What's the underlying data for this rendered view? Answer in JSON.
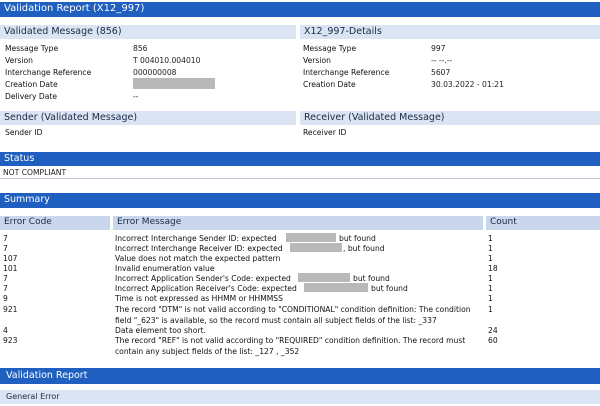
{
  "title": "Validation Report (X12_997)",
  "validated_message": {
    "heading": "Validated Message (856)",
    "rows": [
      {
        "label": "Message Type",
        "value": "856"
      },
      {
        "label": "Version",
        "value": "T 004010.004010"
      },
      {
        "label": "Interchange Reference",
        "value": "000000008"
      },
      {
        "label": "Creation Date",
        "value": ""
      },
      {
        "label": "Delivery Date",
        "value": "--"
      }
    ]
  },
  "details": {
    "heading": "X12_997-Details",
    "rows": [
      {
        "label": "Message Type",
        "value": "997"
      },
      {
        "label": "Version",
        "value": "-- --.--"
      },
      {
        "label": "Interchange Reference",
        "value": "5607"
      },
      {
        "label": "Creation Date",
        "value": "30.03.2022 - 01:21"
      }
    ]
  },
  "sender": {
    "heading": "Sender (Validated Message)",
    "label": "Sender ID"
  },
  "receiver": {
    "heading": "Receiver (Validated Message)",
    "label": "Receiver ID"
  },
  "status": {
    "heading": "Status",
    "value": "NOT COMPLIANT"
  },
  "summary": {
    "heading": "Summary",
    "columns": {
      "code": "Error Code",
      "message": "Error Message",
      "count": "Count"
    },
    "rows": [
      {
        "code": "7",
        "message": "Incorrect Interchange Sender ID: expected",
        "suffix": "but found",
        "count": "1"
      },
      {
        "code": "7",
        "message": "Incorrect Interchange Receiver ID: expected",
        "suffix": ", but found",
        "count": "1"
      },
      {
        "code": "107",
        "message": "Value does not match the expected pattern",
        "count": "1"
      },
      {
        "code": "101",
        "message": "Invalid enumeration value",
        "count": "18"
      },
      {
        "code": "7",
        "message": "Incorrect Application Sender's Code: expected",
        "suffix": "but found",
        "count": "1"
      },
      {
        "code": "7",
        "message": "Incorrect Application Receiver's Code: expected",
        "suffix": "but found",
        "count": "1"
      },
      {
        "code": "9",
        "message": "Time is not expressed as HHMM or HHMMSS",
        "count": "1"
      },
      {
        "code": "921",
        "message": "The record \"DTM\" is not valid according to \"CONDITIONAL\" condition definition: The condition field \"_623\" is available, so the record must contain all subject fields of the list: _337",
        "count": "1"
      },
      {
        "code": "4",
        "message": "Data element too short.",
        "count": "24"
      },
      {
        "code": "923",
        "message": "The record \"REF\" is not valid according to \"REQUIRED\" condition definition. The record must contain any subject fields of the list: _127 , _352",
        "count": "60"
      }
    ]
  },
  "validation_report": {
    "heading": "Validation Report",
    "item": "General Error"
  },
  "colors": {
    "header_dark": "#1f5fbf",
    "header_light": "#dbe4f3",
    "column_header": "#c9d6ec",
    "redaction": "#b8b8b8"
  }
}
